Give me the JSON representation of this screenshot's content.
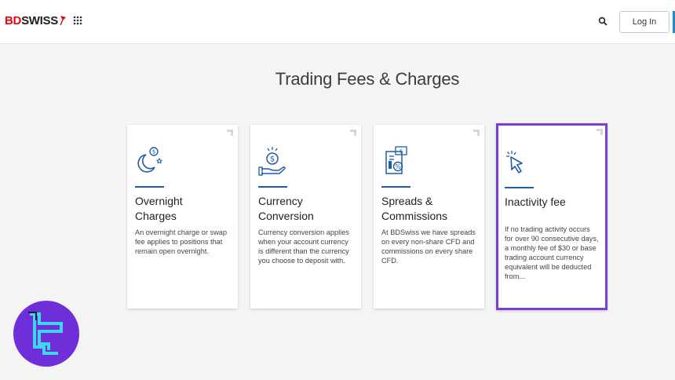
{
  "header": {
    "logo": {
      "part1": "BD",
      "part2": "SWISS"
    },
    "icons": {
      "apps": "apps-grid-icon",
      "search": "search-icon"
    },
    "login_label": "Log In"
  },
  "page": {
    "title": "Trading Fees & Charges"
  },
  "cards": [
    {
      "icon": "moon-coin-icon",
      "title_lines": [
        "Overnight",
        "Charges"
      ],
      "description": "An overnight charge or swap fee applies to positions that remain open overnight."
    },
    {
      "icon": "hand-coin-icon",
      "title_lines": [
        "Currency",
        "Conversion"
      ],
      "description": "Currency conversion applies when your account currency is different than the currency you choose to deposit with."
    },
    {
      "icon": "document-percent-icon",
      "title_lines": [
        "Spreads &",
        "Commissions"
      ],
      "description": "At BDSwiss we have spreads on every non-share CFD and commissions on every share CFD."
    },
    {
      "icon": "cursor-click-icon",
      "title_lines": [
        "Inactivity fee",
        ""
      ],
      "description": "If no trading activity occurs for over 90 consecutive days, a monthly fee of $30 or base trading account currency equivalent will be deducted from..."
    }
  ],
  "colors": {
    "brand_red": "#e30613",
    "accent_blue": "#1e5ba8",
    "highlight_purple": "#7b3fd6",
    "watermark_purple": "#6f2fd8",
    "watermark_cyan": "#3fd7f0"
  }
}
